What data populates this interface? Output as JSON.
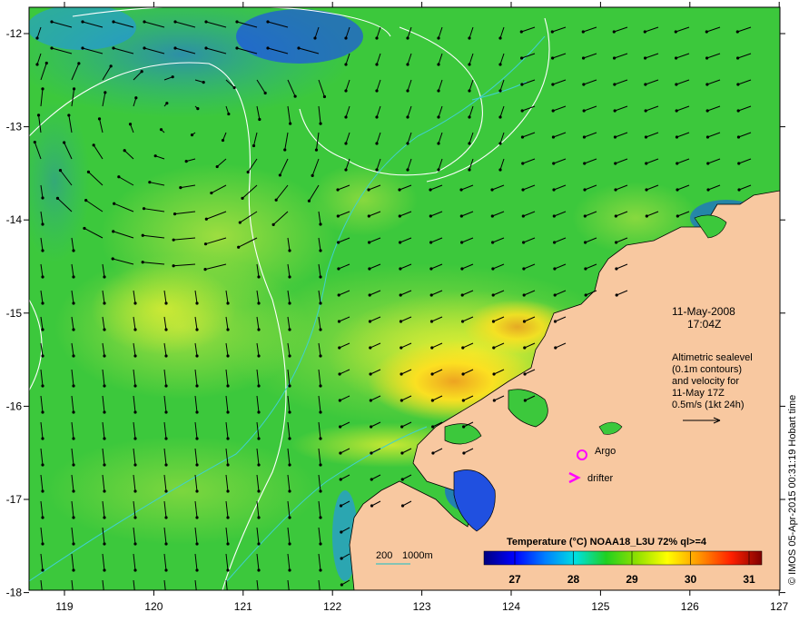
{
  "axes": {
    "lon_ticks": [
      "119",
      "120",
      "121",
      "122",
      "123",
      "124",
      "125",
      "126",
      "127"
    ],
    "lat_ticks": [
      "-12",
      "-13",
      "-14",
      "-15",
      "-16",
      "-17",
      "-18"
    ]
  },
  "info": {
    "date": "11-May-2008",
    "time": "17:04Z",
    "altimetry_lines": [
      "Altimetric sealevel",
      "(0.1m contours)",
      "and velocity for",
      "11-May 17Z",
      "0.5m/s (1kt 24h)"
    ]
  },
  "markers": {
    "argo": "Argo",
    "drifter": "drifter",
    "argo_color": "#ff00ff",
    "drifter_color": "#ff00ff"
  },
  "bathymetry": {
    "label_200": "200",
    "label_1000": "1000m",
    "color": "#40c0c0"
  },
  "colorbar": {
    "title": "Temperature (°C) NOAA18_L3U 72% ql>=4",
    "ticks": [
      "27",
      "28",
      "29",
      "30",
      "31"
    ],
    "colors": [
      "#00007f",
      "#0000ff",
      "#007fff",
      "#00ffff",
      "#00d000",
      "#80e000",
      "#ffff00",
      "#ff8000",
      "#ff0000",
      "#7f0000"
    ]
  },
  "credit": "© IMOS 05-Apr-2015 00:31:19 Hobart time",
  "palette": {
    "land": "#f8c8a0",
    "ocean_base": "#3cc83c",
    "arrow": "#000000"
  }
}
